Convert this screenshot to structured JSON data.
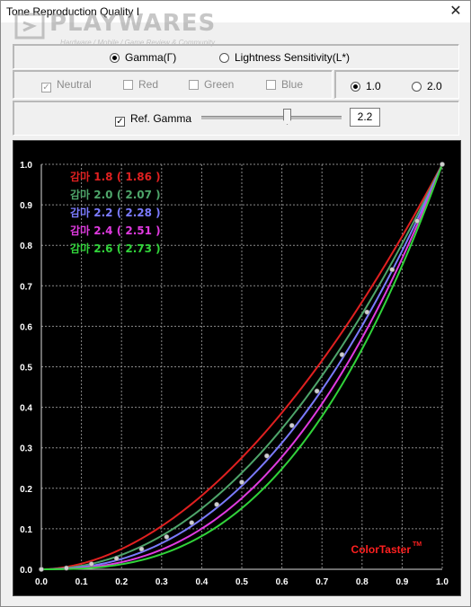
{
  "window": {
    "title": "Tone Reproduction Quality I",
    "close_glyph": "✕"
  },
  "watermark": {
    "name": "PLAYWARES",
    "tagline": "Hardware / Mobile / Game Review & Community"
  },
  "mode": {
    "gamma_label": "Gamma(Γ)",
    "lightness_label": "Lightness Sensitivity(L*)",
    "selected": "gamma"
  },
  "channels": [
    {
      "label": "Neutral",
      "checked": true
    },
    {
      "label": "Red",
      "checked": false
    },
    {
      "label": "Green",
      "checked": false
    },
    {
      "label": "Blue",
      "checked": false
    }
  ],
  "scale": {
    "option1": "1.0",
    "option2": "2.0",
    "selected": "1.0"
  },
  "ref": {
    "label": "Ref. Gamma",
    "checked": true,
    "value": "2.2",
    "slider_fraction": 0.59
  },
  "chart_data": {
    "type": "line",
    "xlim": [
      0,
      1
    ],
    "ylim": [
      0,
      1
    ],
    "x_ticks": [
      "0.0",
      "0.1",
      "0.2",
      "0.3",
      "0.4",
      "0.5",
      "0.6",
      "0.7",
      "0.8",
      "0.9",
      "1.0"
    ],
    "y_ticks": [
      "0.0",
      "0.1",
      "0.2",
      "0.3",
      "0.4",
      "0.5",
      "0.6",
      "0.7",
      "0.8",
      "0.9",
      "1.0"
    ],
    "grid": true,
    "legend_position": "top-left",
    "series": [
      {
        "label": "감마 1.8 ( 1.86 )",
        "gamma": 1.86,
        "color": "#e02020"
      },
      {
        "label": "감마 2.0 ( 2.07 )",
        "gamma": 2.07,
        "color": "#4ea56a"
      },
      {
        "label": "감마 2.2 ( 2.28 )",
        "gamma": 2.28,
        "color": "#7b7bff"
      },
      {
        "label": "감마 2.4 ( 2.51 )",
        "gamma": 2.51,
        "color": "#e03ae0"
      },
      {
        "label": "감마 2.6 ( 2.73 )",
        "gamma": 2.73,
        "color": "#31d43a"
      }
    ],
    "measured_points": {
      "x": [
        0.0,
        0.0625,
        0.125,
        0.1875,
        0.25,
        0.3125,
        0.375,
        0.4375,
        0.5,
        0.5625,
        0.625,
        0.6875,
        0.75,
        0.8125,
        0.875,
        0.9375,
        1.0
      ],
      "y": [
        0.0,
        0.003,
        0.013,
        0.027,
        0.05,
        0.08,
        0.115,
        0.16,
        0.215,
        0.28,
        0.355,
        0.44,
        0.53,
        0.635,
        0.74,
        0.86,
        1.0
      ],
      "color": "#cfcfcf"
    },
    "brand": "ColorTaster",
    "brand_mark": "TM",
    "brand_color": "#ff2020"
  }
}
